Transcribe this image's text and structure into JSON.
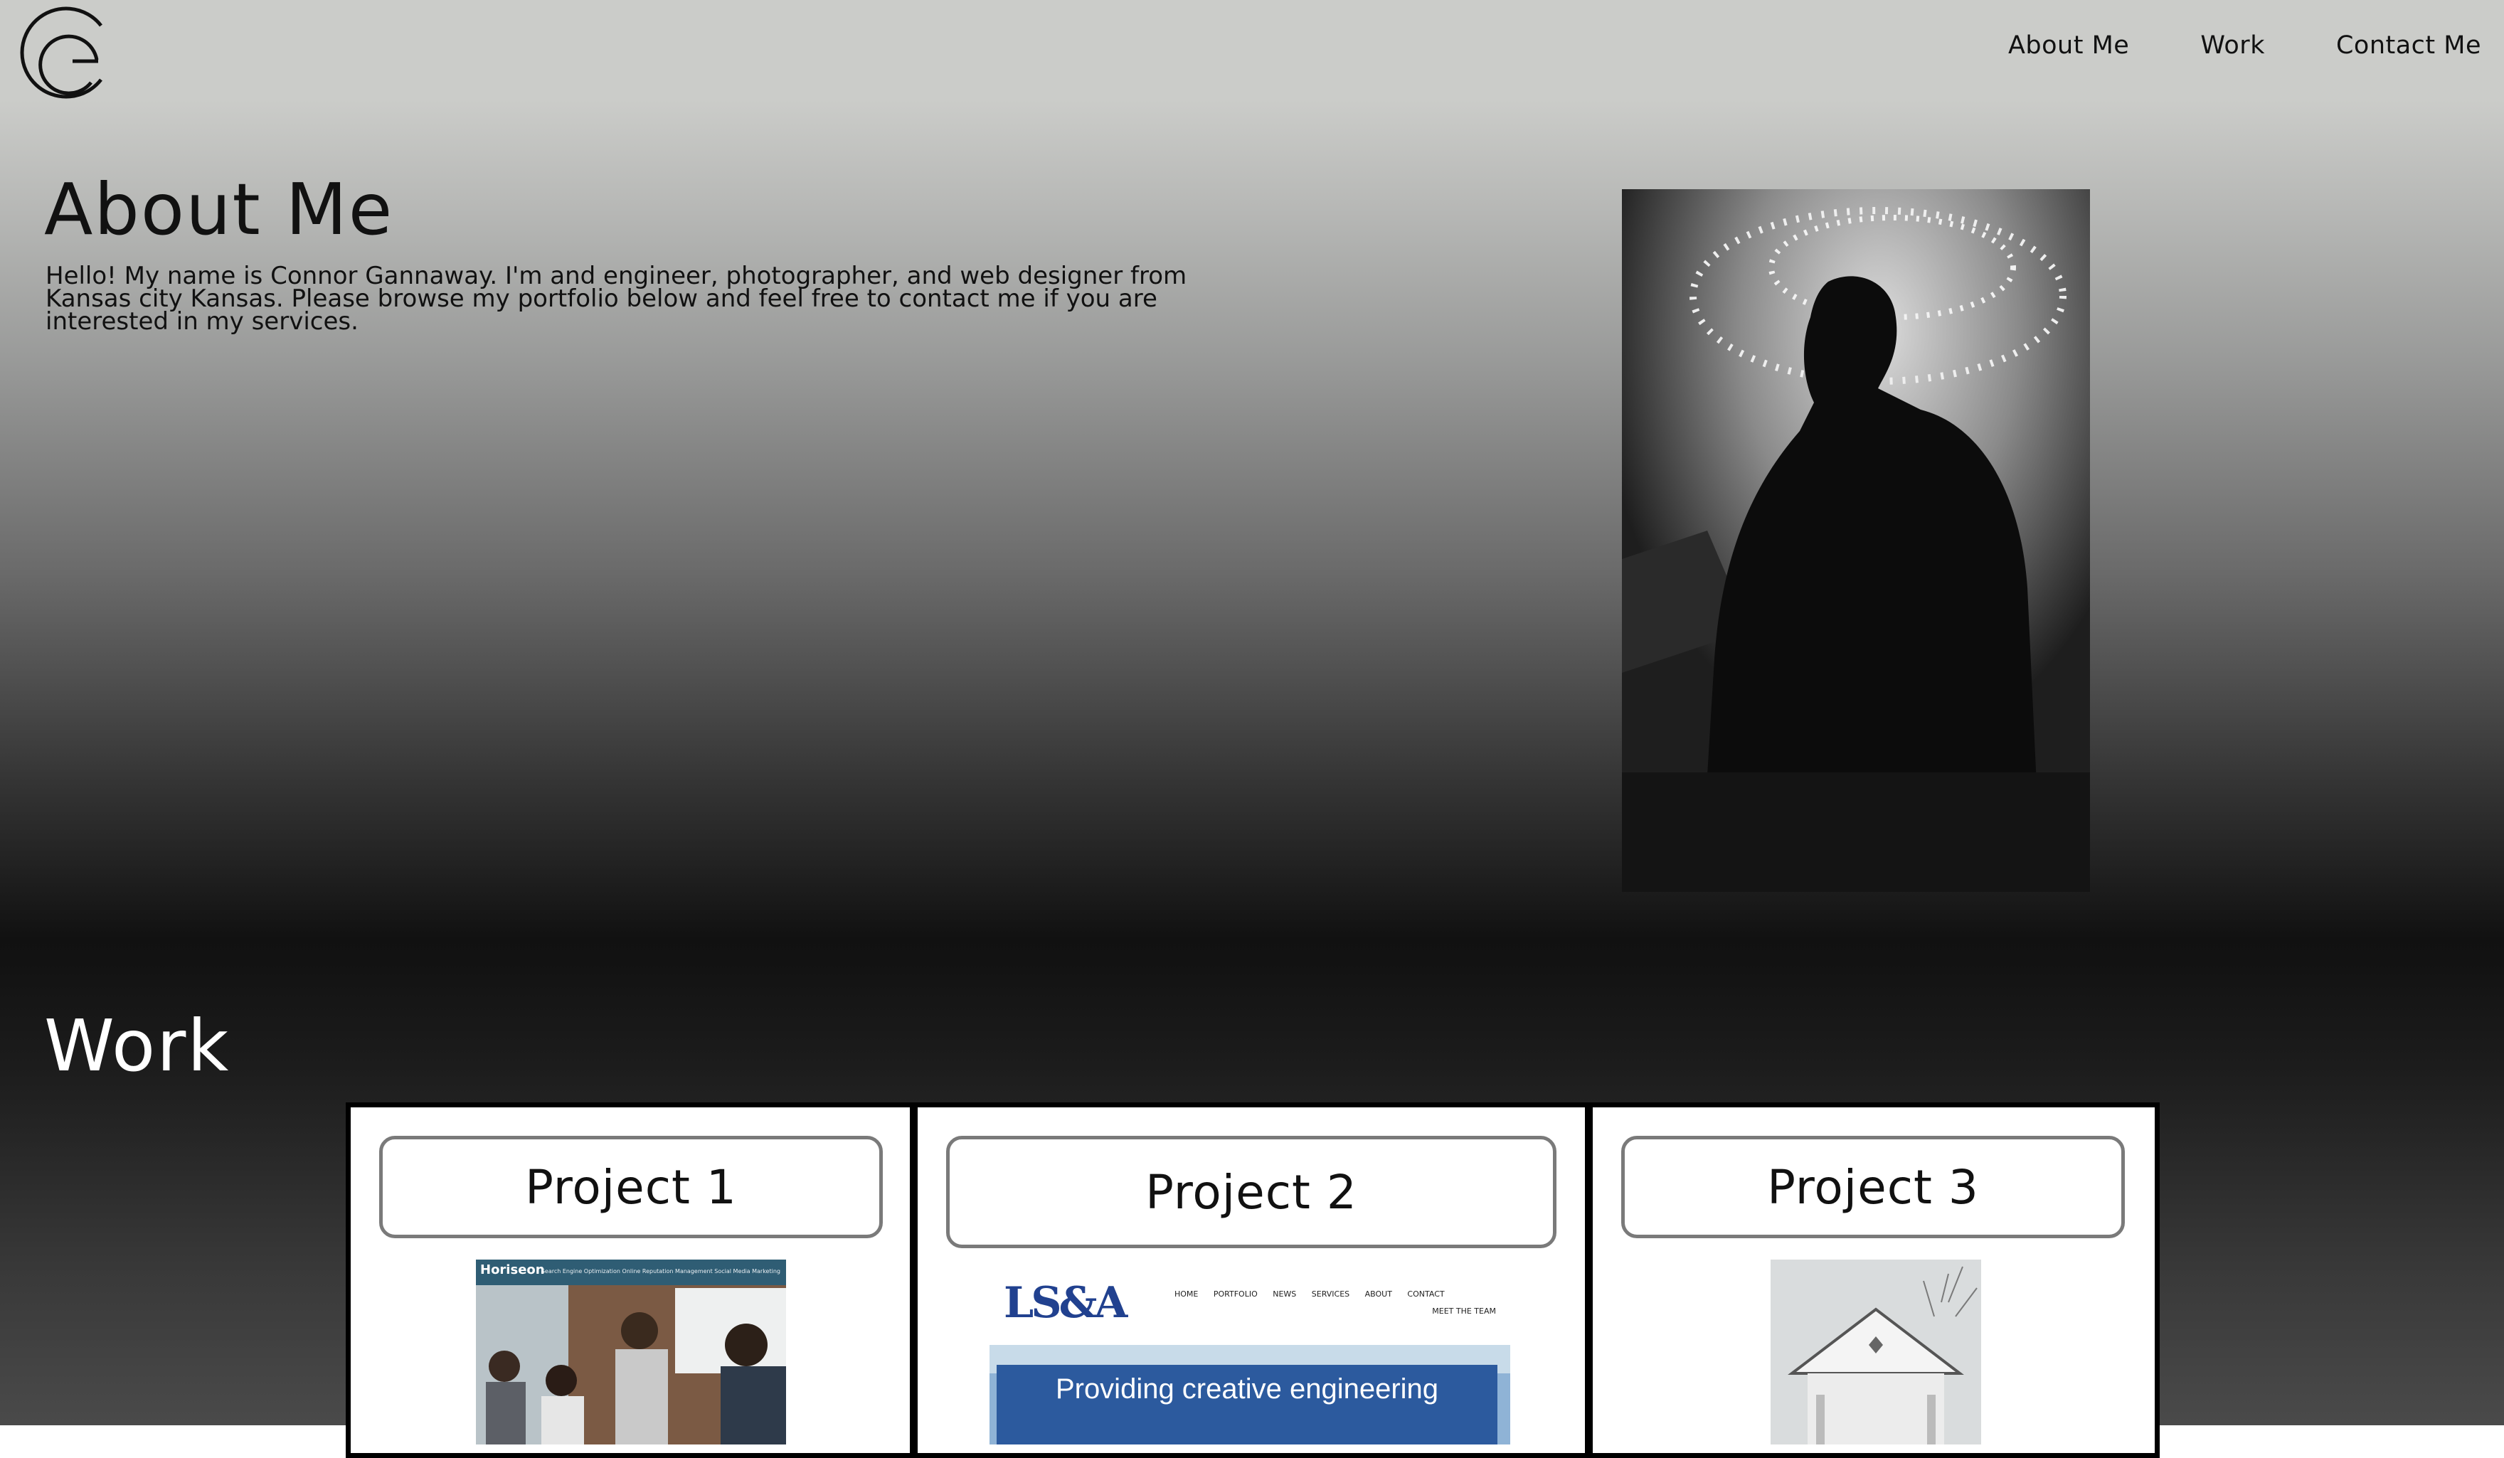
{
  "header": {
    "logo_alt": "CG monogram logo",
    "nav": [
      "About Me",
      "Work",
      "Contact Me"
    ]
  },
  "about": {
    "title": "About Me",
    "text": "Hello! My name is Connor Gannaway. I'm and engineer, photographer, and web designer from Kansas city Kansas. Please browse my portfolio below and feel free to contact me if you are interested in my services."
  },
  "work": {
    "title": "Work",
    "projects": [
      {
        "label": "Project 1",
        "thumb": {
          "brand": "Horiseon",
          "links": "Search Engine Optimization   Online Reputation Management   Social Media Marketing"
        }
      },
      {
        "label": "Project 2",
        "thumb": {
          "logo": "LS&A",
          "nav": "HOME PORTFOLIO NEWS SERVICES ABOUT CONTACT",
          "sub": "MEET THE TEAM",
          "banner": "Providing creative engineering"
        }
      },
      {
        "label": "Project 3"
      }
    ]
  },
  "colors": {
    "header_bg": "#cbccc9",
    "dark_band": "#111111",
    "card_border": "#000000",
    "label_border": "#7a7a7a",
    "lsa_blue": "#21418f"
  }
}
